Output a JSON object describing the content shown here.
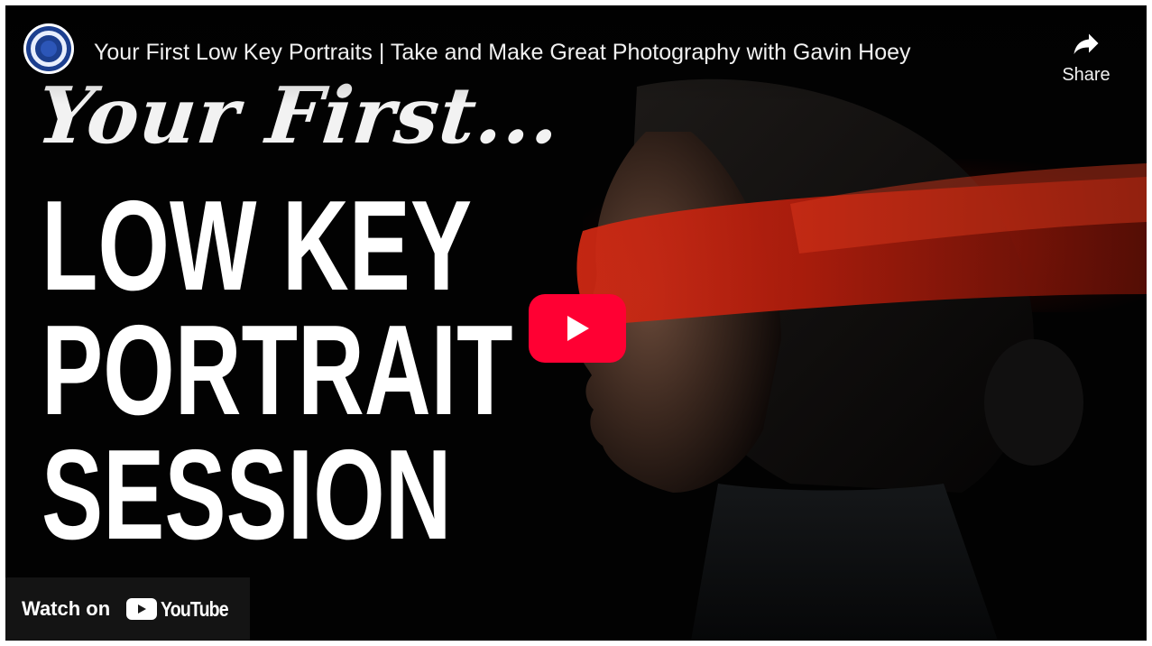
{
  "player": {
    "title": "Your First Low Key Portraits | Take and Make Great Photography with Gavin Hoey",
    "share_label": "Share",
    "watch_on_label": "Watch on",
    "youtube_wordmark": "YouTube"
  },
  "thumbnail": {
    "script_text": "Your First...",
    "line1": "LOW KEY",
    "line2": "PORTRAIT",
    "line3": "SESSION"
  },
  "icons": {
    "channel": "channel-avatar-icon",
    "share": "share-arrow-icon",
    "play": "play-icon",
    "youtube": "youtube-logo-icon"
  },
  "colors": {
    "play_red": "#ff0033",
    "scarf_red": "#c81e10",
    "avatar_blue": "#1c3f8f"
  }
}
